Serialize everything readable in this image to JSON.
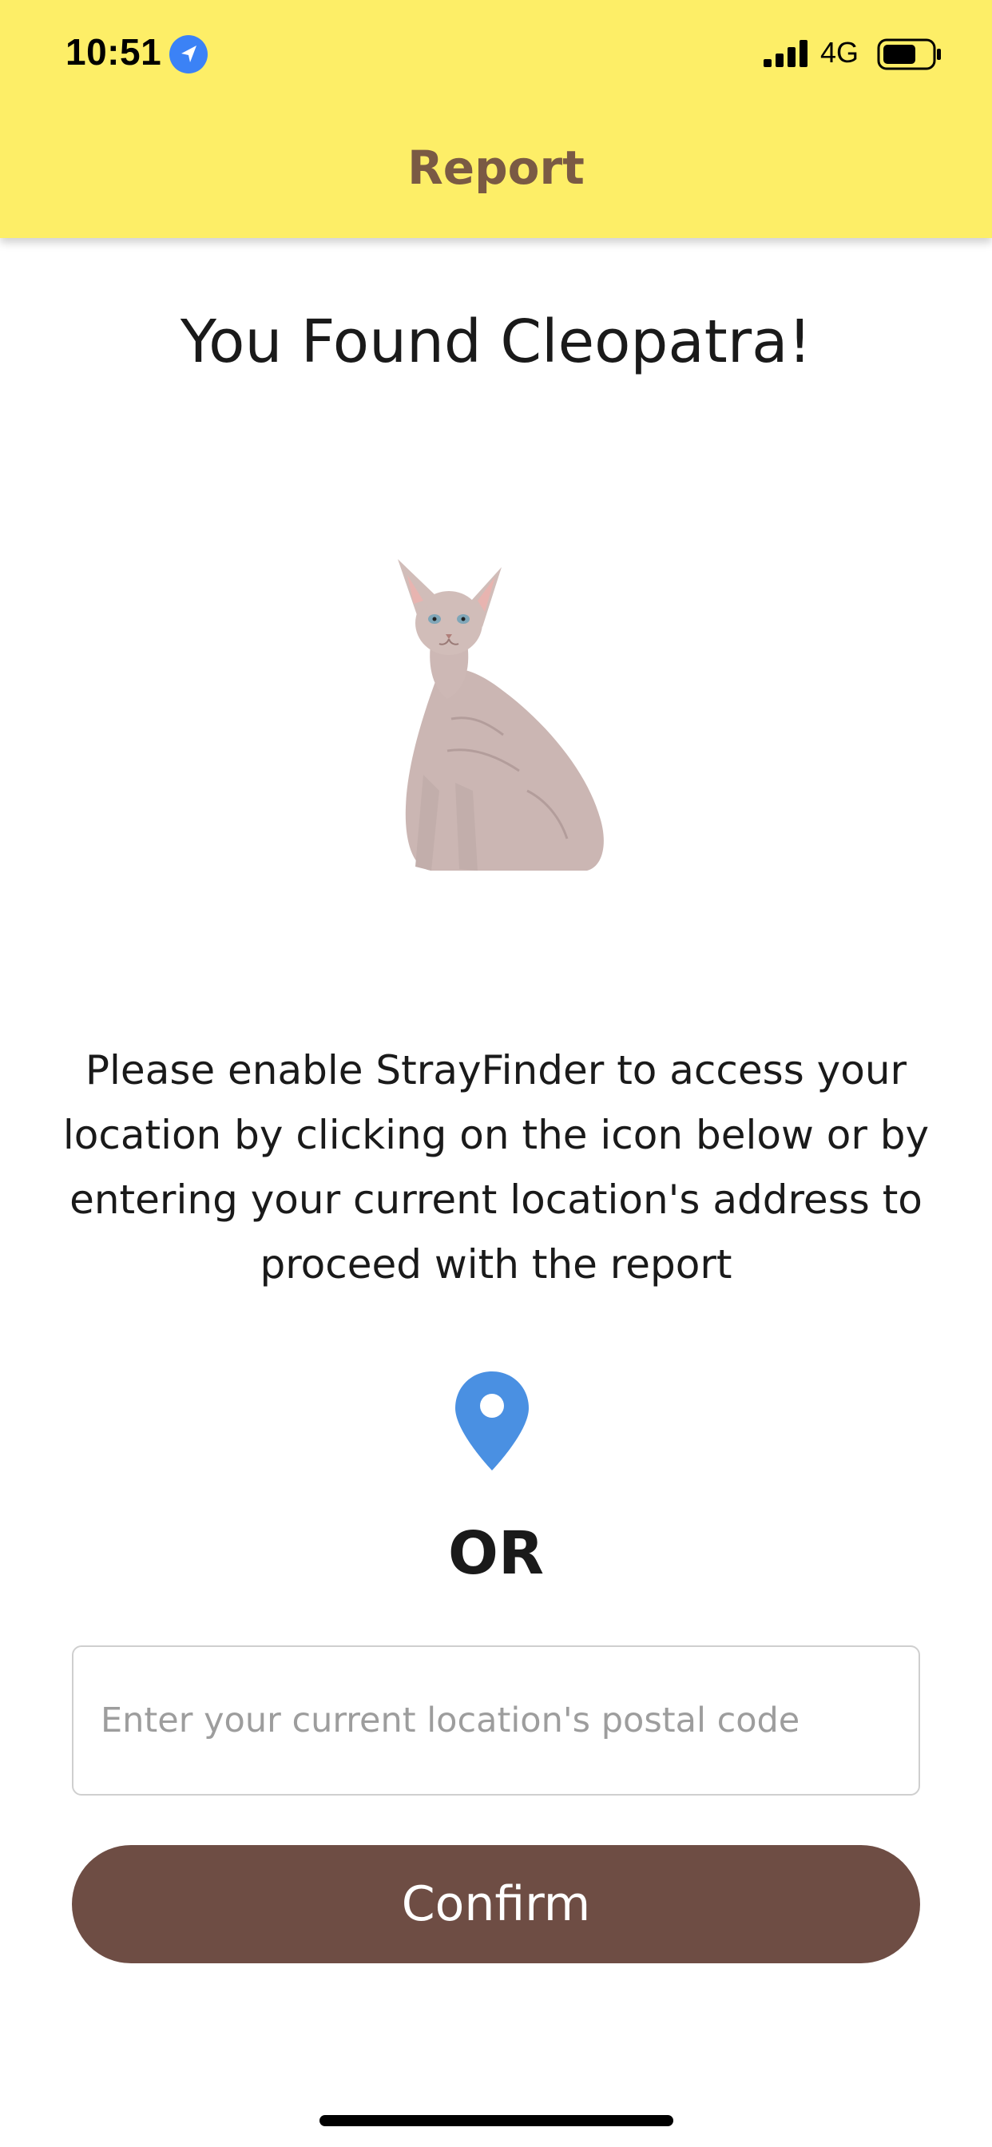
{
  "status_bar": {
    "time": "10:51",
    "network": "4G",
    "location_icon": "location-arrow-icon",
    "signal_icon": "cellular-signal-icon",
    "battery_icon": "battery-icon"
  },
  "header": {
    "title": "Report",
    "background_color": "#fdee67",
    "title_color": "#7a5a44"
  },
  "main": {
    "heading": "You Found Cleopatra!",
    "pet_image": "sphynx-cat-image",
    "instructions": "Please enable StrayFinder to access your location by clicking on the icon below or by entering your current location's address to proceed with the report",
    "location_button_icon": "map-pin-icon",
    "location_icon_color": "#4a90e2",
    "or_label": "OR",
    "postal_code_input": {
      "value": "",
      "placeholder": "Enter your current location's postal code"
    },
    "confirm_label": "Confirm",
    "confirm_color": "#6e4d44"
  }
}
